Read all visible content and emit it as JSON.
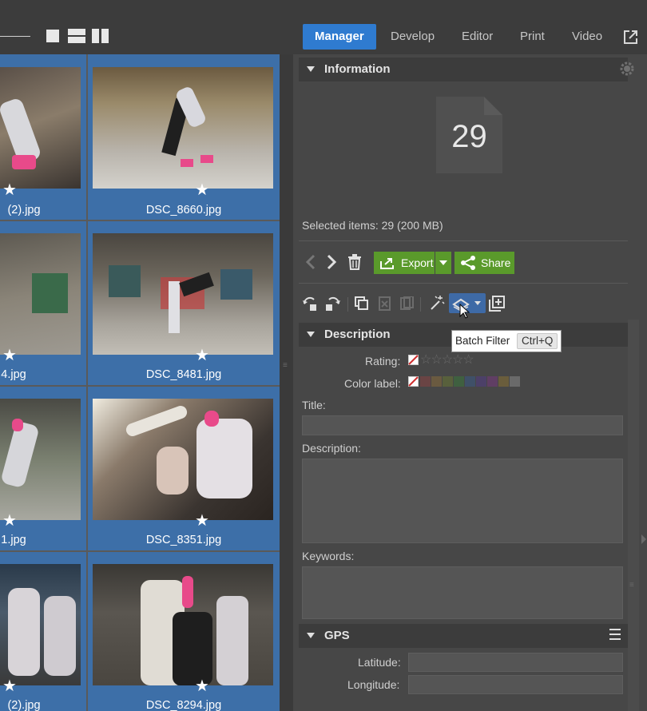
{
  "topbar": {
    "tabs": [
      {
        "label": "Manager",
        "active": true
      },
      {
        "label": "Develop",
        "active": false
      },
      {
        "label": "Editor",
        "active": false
      },
      {
        "label": "Print",
        "active": false
      },
      {
        "label": "Video",
        "active": false
      }
    ],
    "view_icons": [
      "single-view-icon",
      "compare-view-icon",
      "filmstrip-view-icon"
    ],
    "external_icon": "external-window-icon"
  },
  "grid": {
    "files": [
      "(2).jpg",
      "DSC_8660.jpg",
      "4.jpg",
      "DSC_8481.jpg",
      "1.jpg",
      "DSC_8351.jpg",
      "(2).jpg",
      "DSC_8294.jpg"
    ],
    "star_glyph": "★"
  },
  "info": {
    "title": "Information",
    "count": "29",
    "selected_text": "Selected items: 29 (200 MB)",
    "export_label": "Export",
    "share_label": "Share"
  },
  "tooltip": {
    "label": "Batch Filter",
    "shortcut": "Ctrl+Q"
  },
  "description": {
    "title": "Description",
    "rating_label": "Rating:",
    "color_label": "Color label:",
    "title_label": "Title:",
    "description_label": "Description:",
    "keywords_label": "Keywords:",
    "rating_stars": "☆☆☆☆☆",
    "swatch_colors": [
      "#6a4444",
      "#6a5a40",
      "#58603c",
      "#3f6040",
      "#3f5068",
      "#4c4068",
      "#603e64",
      "#6a5d3c",
      "#6a6a6a",
      "#3e3e3e"
    ]
  },
  "gps": {
    "title": "GPS",
    "latitude_label": "Latitude:",
    "longitude_label": "Longitude:"
  },
  "colors": {
    "accent": "#2f7bd0",
    "green": "#5a9a2b",
    "selection": "#3d6fa8"
  }
}
